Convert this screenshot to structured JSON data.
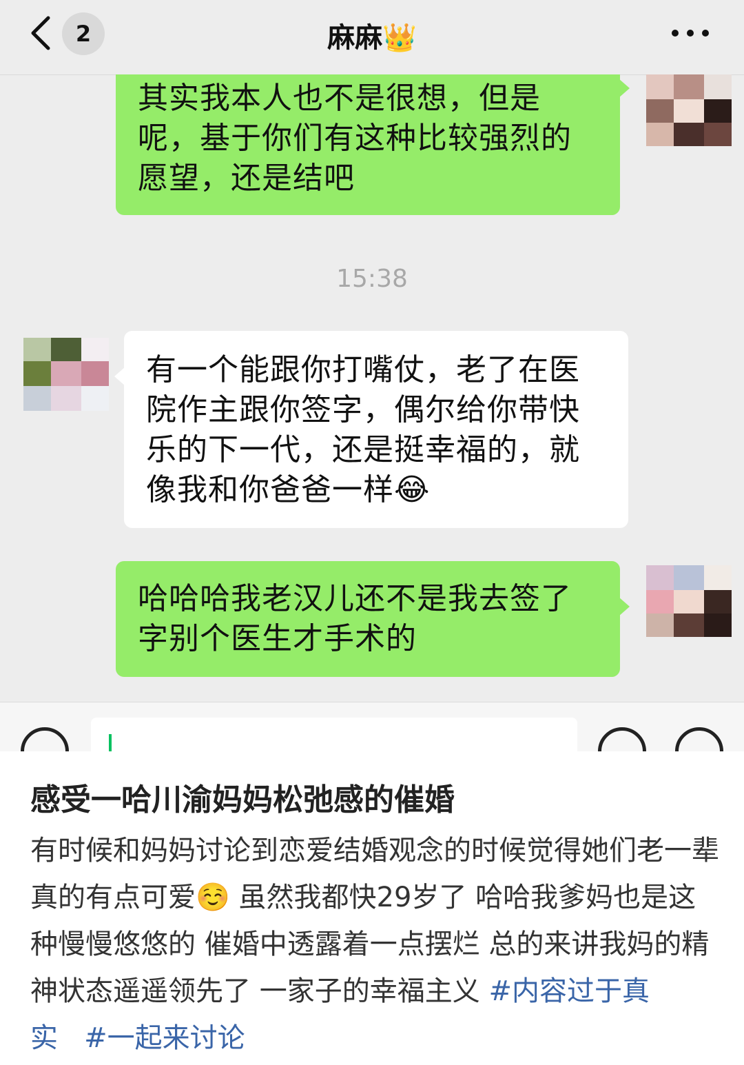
{
  "header": {
    "back_count": "2",
    "title": "麻麻",
    "title_emoji": "👑"
  },
  "messages": [
    {
      "side": "right",
      "text": "其实我本人也不是很想，但是呢，基于你们有这种比较强烈的愿望，还是结吧"
    },
    {
      "side": "left",
      "text": "有一个能跟你打嘴仗，老了在医院作主跟你签字，偶尔给你带快乐的下一代，还是挺幸福的，就像我和你爸爸一样",
      "emoji": "😂"
    },
    {
      "side": "right",
      "text": "哈哈哈我老汉儿还不是我去签了字别个医生才手术的"
    }
  ],
  "timestamp": "15:38",
  "post": {
    "title": "感受一哈川渝妈妈松弛感的催婚",
    "body_1": "有时候和妈妈讨论到恋爱结婚观念的时候觉得她们老一辈真的有点可爱",
    "body_emoji": "☺️",
    "body_2": " 虽然我都快29岁了 哈哈我爹妈也是这种慢慢悠悠的 催婚中透露着一点摆烂 总的来讲我妈的精神状态遥遥领先了 一家子的幸福主义 ",
    "tag_1": "#内容过于真实",
    "tag_2": "#一起来讨论"
  },
  "colors": {
    "chat_bg": "#ededed",
    "bubble_green": "#95ec69",
    "bubble_white": "#ffffff",
    "tag_blue": "#3a65a8"
  }
}
